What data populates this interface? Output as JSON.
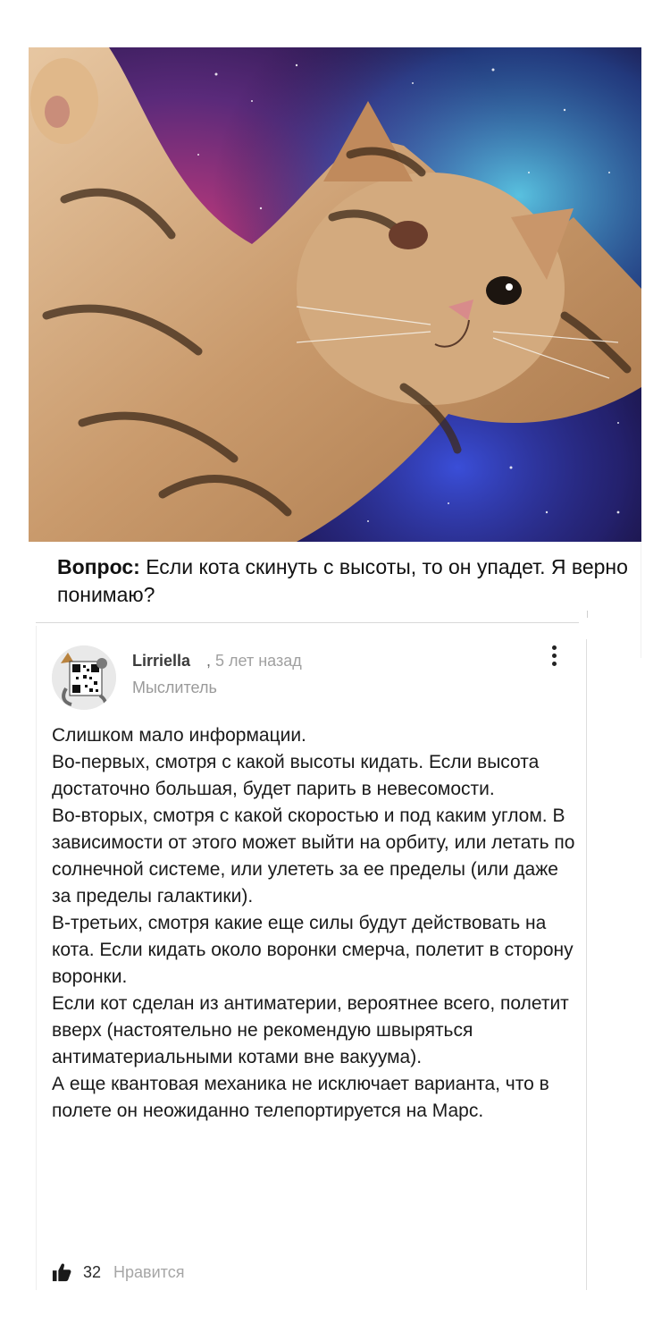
{
  "question": {
    "label": "Вопрос:",
    "text": "Если кота скинуть с высоты, то он упадет. Я верно понимаю?"
  },
  "comment": {
    "author": "Lirriella",
    "separator": ",",
    "time": "5 лет назад",
    "rank": "Мыслитель",
    "paragraphs": [
      "Слишком мало информации.",
      "Во-первых, смотря с какой высоты кидать. Если высота достаточно большая, будет парить в невесомости.",
      "Во-вторых, смотря с какой скоростью и под каким углом. В зависимости от этого может выйти на орбиту, или летать по солнечной системе, или улететь за ее пределы (или даже за пределы галактики).",
      "В-третьих, смотря какие еще силы будут действовать на кота. Если кидать около воронки смерча, полетит в сторону воронки.",
      "Если кот сделан из антиматерии, вероятнее всего, полетит вверх (настоятельно не рекомендую швыряться антиматериальными котами вне вакуума).",
      "А еще квантовая механика не исключает варианта, что в полете он неожиданно телепортируется на Марс."
    ],
    "likes": "32",
    "like_label": "Нравится"
  },
  "icons": {
    "menu": "kebab-menu-icon",
    "like": "thumbs-up-icon",
    "avatar": "qr-code-cat-avatar"
  },
  "colors": {
    "text": "#111111",
    "muted": "#a0a0a0",
    "divider": "#d9d9d9"
  }
}
